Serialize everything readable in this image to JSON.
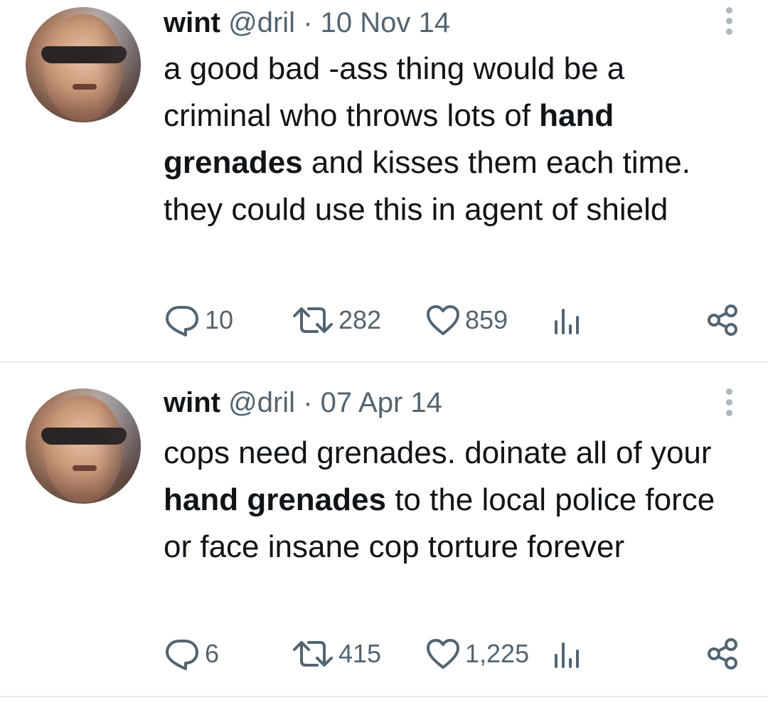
{
  "tweets": [
    {
      "author_name": "wint",
      "author_handle": "@dril",
      "separator": "·",
      "date": "10 Nov 14",
      "text_segments": [
        {
          "text": "a good bad -ass thing would be a criminal who throws lots of ",
          "bold": false
        },
        {
          "text": "hand grenades",
          "bold": true
        },
        {
          "text": " and kisses them each time. they could use this in agent of shield",
          "bold": false
        }
      ],
      "replies": "10",
      "retweets": "282",
      "likes": "859"
    },
    {
      "author_name": "wint",
      "author_handle": "@dril",
      "separator": "·",
      "date": "07 Apr 14",
      "text_segments": [
        {
          "text": "cops need grenades. doinate all of your ",
          "bold": false
        },
        {
          "text": "hand grenades",
          "bold": true
        },
        {
          "text": " to the local police force or face insane cop torture forever",
          "bold": false
        }
      ],
      "replies": "6",
      "retweets": "415",
      "likes": "1,225"
    }
  ],
  "icons": {
    "reply": "reply-icon",
    "retweet": "retweet-icon",
    "like": "heart-icon",
    "views": "views-icon",
    "share": "share-icon",
    "more": "more-options-icon"
  },
  "colors": {
    "text": "#0f1419",
    "secondary": "#536471",
    "divider": "#e6ecf0"
  }
}
